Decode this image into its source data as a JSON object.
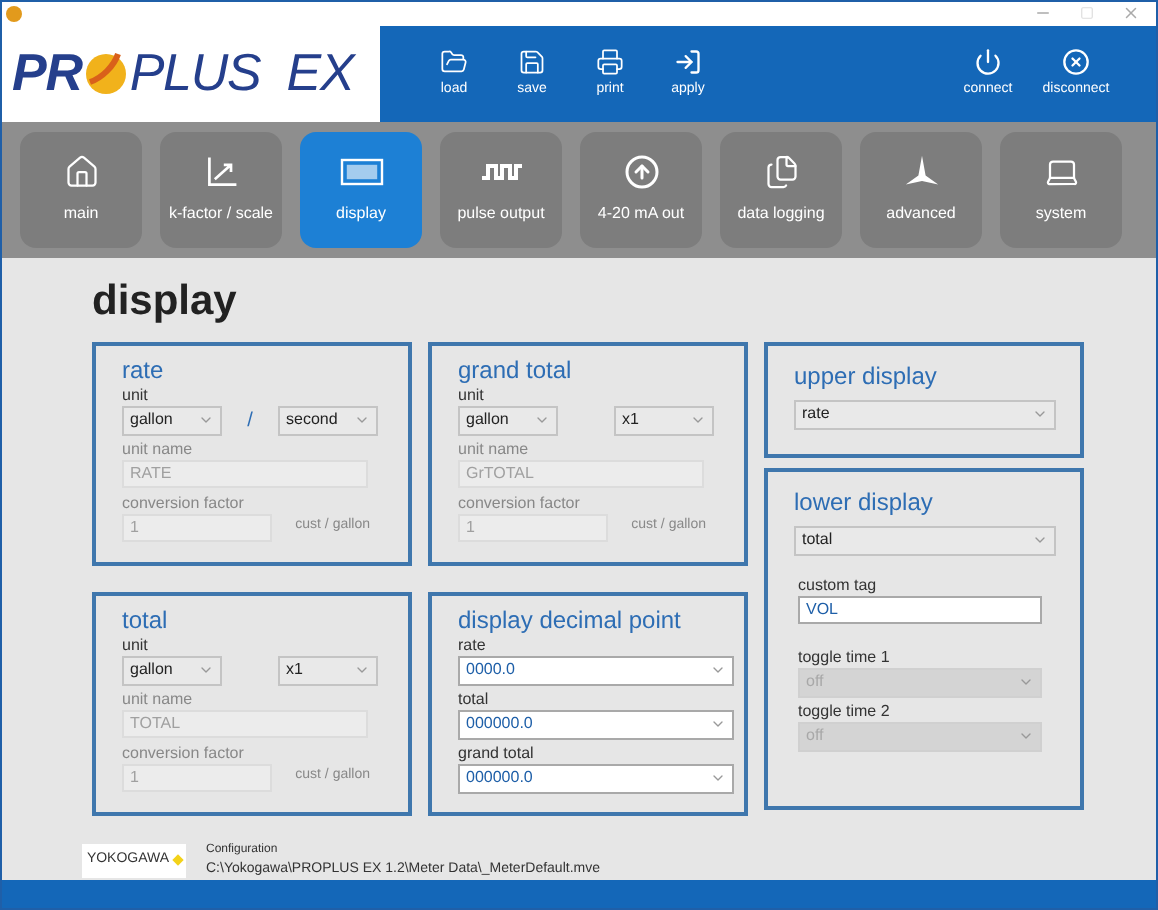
{
  "logo": {
    "first": "PR",
    "rest": "PLUS  EX"
  },
  "toolbar": [
    {
      "label": "load"
    },
    {
      "label": "save"
    },
    {
      "label": "print"
    },
    {
      "label": "apply"
    }
  ],
  "connection": [
    {
      "label": "connect"
    },
    {
      "label": "disconnect"
    }
  ],
  "tabs": [
    {
      "label": "main",
      "selected": false
    },
    {
      "label": "k-factor / scale",
      "selected": false
    },
    {
      "label": "display",
      "selected": true
    },
    {
      "label": "pulse output",
      "selected": false
    },
    {
      "label": "4-20 mA out",
      "selected": false
    },
    {
      "label": "data logging",
      "selected": false
    },
    {
      "label": "advanced",
      "selected": false
    },
    {
      "label": "system",
      "selected": false
    }
  ],
  "heading": "display",
  "unit_panels": [
    {
      "title": "rate",
      "unit_label": "unit",
      "unit": "gallon",
      "separator": "/",
      "unit_2": "second",
      "unit_name_label": "unit name",
      "unit_name": "RATE",
      "conversion_label": "conversion factor",
      "conversion_factor": "1",
      "conversion_unit": "cust / gallon"
    },
    {
      "title": "grand total",
      "unit_label": "unit",
      "unit": "gallon",
      "unit_2": "x1",
      "unit_name_label": "unit name",
      "unit_name": "GrTOTAL",
      "conversion_label": "conversion factor",
      "conversion_factor": "1",
      "conversion_unit": "cust / gallon"
    },
    {
      "title": "total",
      "unit_label": "unit",
      "unit": "gallon",
      "unit_2": "x1",
      "unit_name_label": "unit name",
      "unit_name": "TOTAL",
      "conversion_label": "conversion factor",
      "conversion_factor": "1",
      "conversion_unit": "cust / gallon"
    }
  ],
  "upper_display": {
    "title": "upper display",
    "value": "rate"
  },
  "lower_display": {
    "title": "lower display",
    "value": "total",
    "custom_tag_label": "custom tag",
    "custom_tag": "VOL",
    "toggles": [
      {
        "label": "toggle time 1",
        "value": "off",
        "disabled": true
      },
      {
        "label": "toggle time 2",
        "value": "off",
        "disabled": true
      }
    ]
  },
  "decimal_point": {
    "title": "display decimal point",
    "fields": [
      {
        "label": "rate",
        "value": "0000.0"
      },
      {
        "label": "total",
        "value": "000000.0"
      },
      {
        "label": "grand total",
        "value": "000000.0"
      }
    ]
  },
  "footer": {
    "brand": "YOKOGAWA",
    "config_label": "Configuration",
    "config_path": "C:\\Yokogawa\\PROPLUS EX 1.2\\Meter Data\\_MeterDefault.mve"
  }
}
